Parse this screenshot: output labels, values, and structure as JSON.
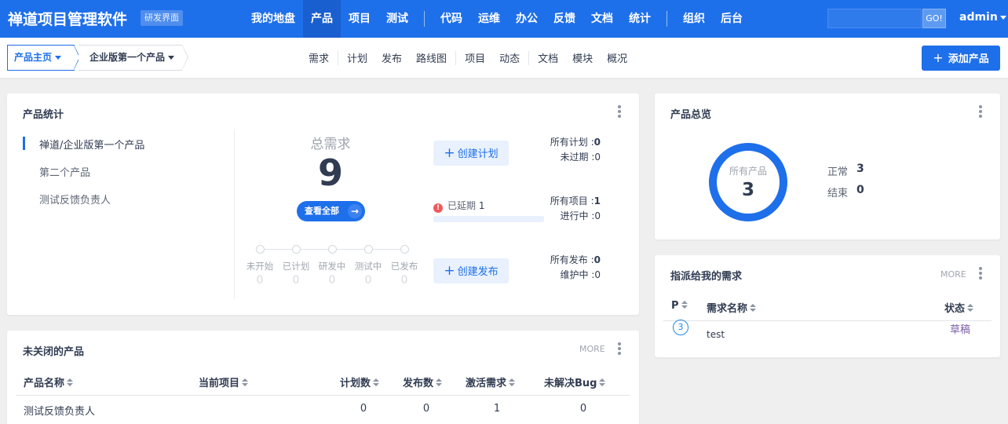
{
  "header": {
    "brand": "禅道项目管理软件",
    "brand_tag": "研发界面",
    "nav": [
      "我的地盘",
      "产品",
      "项目",
      "测试",
      "代码",
      "运维",
      "办公",
      "反馈",
      "文档",
      "统计",
      "组织",
      "后台"
    ],
    "active_nav": "产品",
    "search_go": "GO!",
    "user": "admin"
  },
  "subheader": {
    "crumb_home": "产品主页",
    "crumb_product": "企业版第一个产品",
    "nav": [
      "需求",
      "计划",
      "发布",
      "路线图",
      "项目",
      "动态",
      "文档",
      "模块",
      "概况"
    ],
    "add_button": "添加产品",
    "add_icon": "plus-icon"
  },
  "stats": {
    "title": "产品统计",
    "products": [
      "禅道/企业版第一个产品",
      "第二个产品",
      "测试反馈负责人"
    ],
    "total_label": "总需求",
    "total_value": "9",
    "view_all": "查看全部",
    "stages": [
      {
        "label": "未开始",
        "value": "0"
      },
      {
        "label": "已计划",
        "value": "0"
      },
      {
        "label": "研发中",
        "value": "0"
      },
      {
        "label": "测试中",
        "value": "0"
      },
      {
        "label": "已发布",
        "value": "0"
      }
    ],
    "create_plan": "创建计划",
    "delayed_label": "已延期",
    "delayed_value": "1",
    "create_release": "创建发布",
    "plans_all_label": "所有计划 :",
    "plans_all_value": "0",
    "plans_unexpired_label": "未过期 :",
    "plans_unexpired_value": "0",
    "projects_all_label": "所有项目 :",
    "projects_all_value": "1",
    "projects_doing_label": "进行中 :",
    "projects_doing_value": "0",
    "releases_all_label": "所有发布 :",
    "releases_all_value": "0",
    "releases_maint_label": "维护中 :",
    "releases_maint_value": "0"
  },
  "overview": {
    "title": "产品总览",
    "ring_label": "所有产品",
    "ring_value": "3",
    "normal_label": "正常",
    "normal_value": "3",
    "closed_label": "结束",
    "closed_value": "0",
    "ring_color": "#1e6fea"
  },
  "unclosed": {
    "title": "未关闭的产品",
    "more": "MORE",
    "columns": [
      "产品名称",
      "当前项目",
      "计划数",
      "发布数",
      "激活需求",
      "未解决Bug"
    ],
    "rows": [
      {
        "name": "测试反馈负责人",
        "project": "",
        "plans": "0",
        "releases": "0",
        "active_stories": "1",
        "bugs": "0"
      }
    ]
  },
  "assigned": {
    "title": "指派给我的需求",
    "more": "MORE",
    "columns": [
      "P",
      "需求名称",
      "状态"
    ],
    "rows": [
      {
        "pri": "3",
        "name": "test",
        "status": "草稿"
      }
    ]
  },
  "colors": {
    "primary": "#1e6fea",
    "header_bg": "#1e6fea",
    "draft": "#7b5ea8",
    "warn": "#f1595b"
  }
}
